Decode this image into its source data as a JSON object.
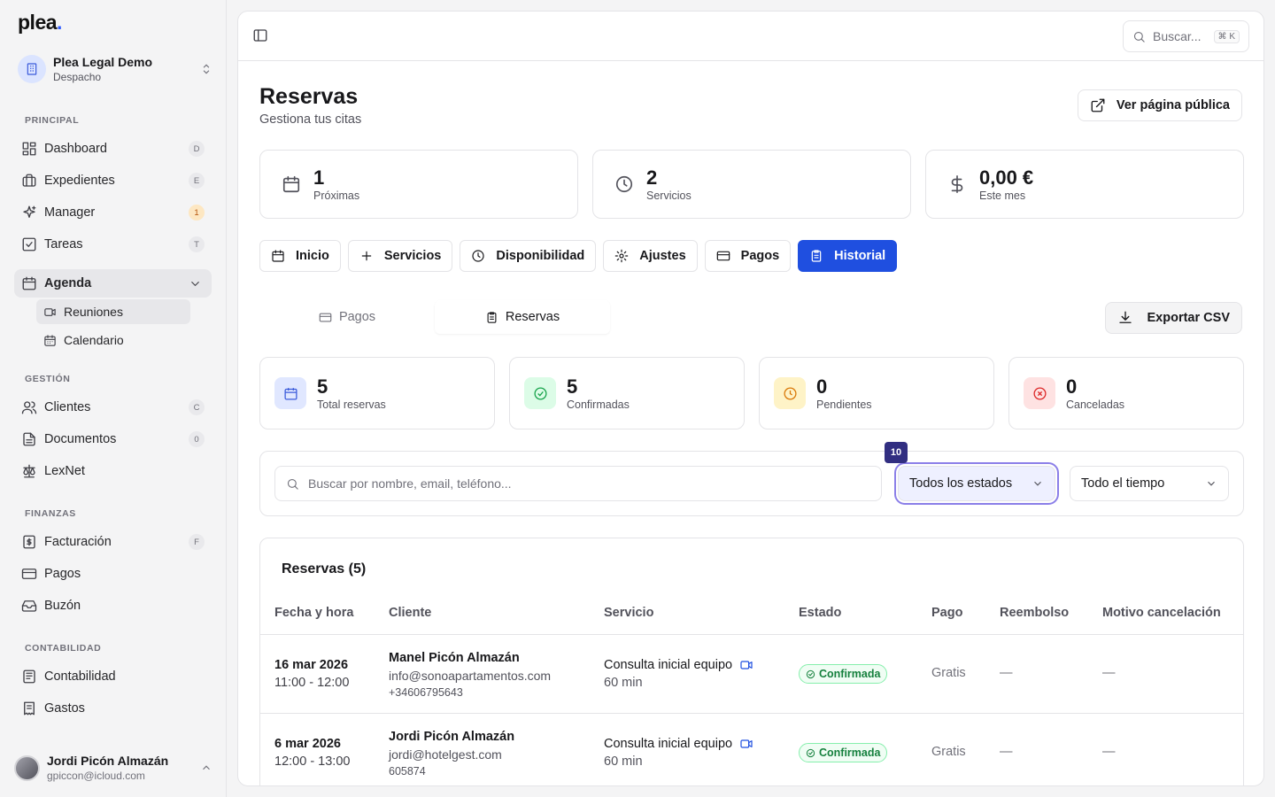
{
  "sidebar": {
    "logo": "plea",
    "logo_dot": ".",
    "org": {
      "name": "Plea Legal Demo",
      "type": "Despacho"
    },
    "sections": {
      "principal": "PRINCIPAL",
      "gestion": "GESTIÓN",
      "finanzas": "FINANZAS",
      "contabilidad": "CONTABILIDAD"
    },
    "items": {
      "dashboard": {
        "label": "Dashboard",
        "key": "D"
      },
      "expedientes": {
        "label": "Expedientes",
        "key": "E"
      },
      "manager": {
        "label": "Manager",
        "key": "1"
      },
      "tareas": {
        "label": "Tareas",
        "key": "T"
      },
      "agenda": {
        "label": "Agenda"
      },
      "reuniones": {
        "label": "Reuniones"
      },
      "calendario": {
        "label": "Calendario"
      },
      "clientes": {
        "label": "Clientes",
        "key": "C"
      },
      "documentos": {
        "label": "Documentos",
        "key": "0"
      },
      "lexnet": {
        "label": "LexNet"
      },
      "facturacion": {
        "label": "Facturación",
        "key": "F"
      },
      "pagos": {
        "label": "Pagos"
      },
      "buzon": {
        "label": "Buzón"
      },
      "contabilidad": {
        "label": "Contabilidad"
      },
      "gastos": {
        "label": "Gastos"
      }
    },
    "user": {
      "name": "Jordi Picón Almazán",
      "email": "gpiccon@icloud.com"
    }
  },
  "topbar": {
    "search_placeholder": "Buscar...",
    "search_shortcut": "⌘ K"
  },
  "page": {
    "title": "Reservas",
    "subtitle": "Gestiona tus citas",
    "public_button": "Ver página pública"
  },
  "stats": [
    {
      "value": "1",
      "label": "Próximas"
    },
    {
      "value": "2",
      "label": "Servicios"
    },
    {
      "value": "0,00 €",
      "label": "Este mes"
    }
  ],
  "tabs": [
    "Inicio",
    "Servicios",
    "Disponibilidad",
    "Ajustes",
    "Pagos",
    "Historial"
  ],
  "subtabs": [
    "Pagos",
    "Reservas"
  ],
  "export_button": "Exportar CSV",
  "summary": [
    {
      "value": "5",
      "label": "Total reservas",
      "color": "#3b5bdb",
      "bg": "#e0e7ff"
    },
    {
      "value": "5",
      "label": "Confirmadas",
      "color": "#16a34a",
      "bg": "#dcfce7"
    },
    {
      "value": "0",
      "label": "Pendientes",
      "color": "#d97706",
      "bg": "#fef3c7"
    },
    {
      "value": "0",
      "label": "Canceladas",
      "color": "#dc2626",
      "bg": "#fee2e2"
    }
  ],
  "filters": {
    "search_placeholder": "Buscar por nombre, email, teléfono...",
    "status": "Todos los estados",
    "period": "Todo el tiempo",
    "focus_badge": "10"
  },
  "table": {
    "title": "Reservas (5)",
    "columns": [
      "Fecha y hora",
      "Cliente",
      "Servicio",
      "Estado",
      "Pago",
      "Reembolso",
      "Motivo cancelación"
    ],
    "rows": [
      {
        "date": "16 mar 2026",
        "time": "11:00 - 12:00",
        "client": "Manel Picón Almazán",
        "email": "info@sonoapartamentos.com",
        "phone": "+34606795643",
        "service": "Consulta inicial equipo",
        "duration": "60 min",
        "status": "Confirmada",
        "payment": "Gratis",
        "refund": "—",
        "reason": "—"
      },
      {
        "date": "6 mar 2026",
        "time": "12:00 - 13:00",
        "client": "Jordi Picón Almazán",
        "email": "jordi@hotelgest.com",
        "phone": "605874",
        "service": "Consulta inicial equipo",
        "duration": "60 min",
        "status": "Confirmada",
        "payment": "Gratis",
        "refund": "—",
        "reason": "—"
      }
    ]
  }
}
